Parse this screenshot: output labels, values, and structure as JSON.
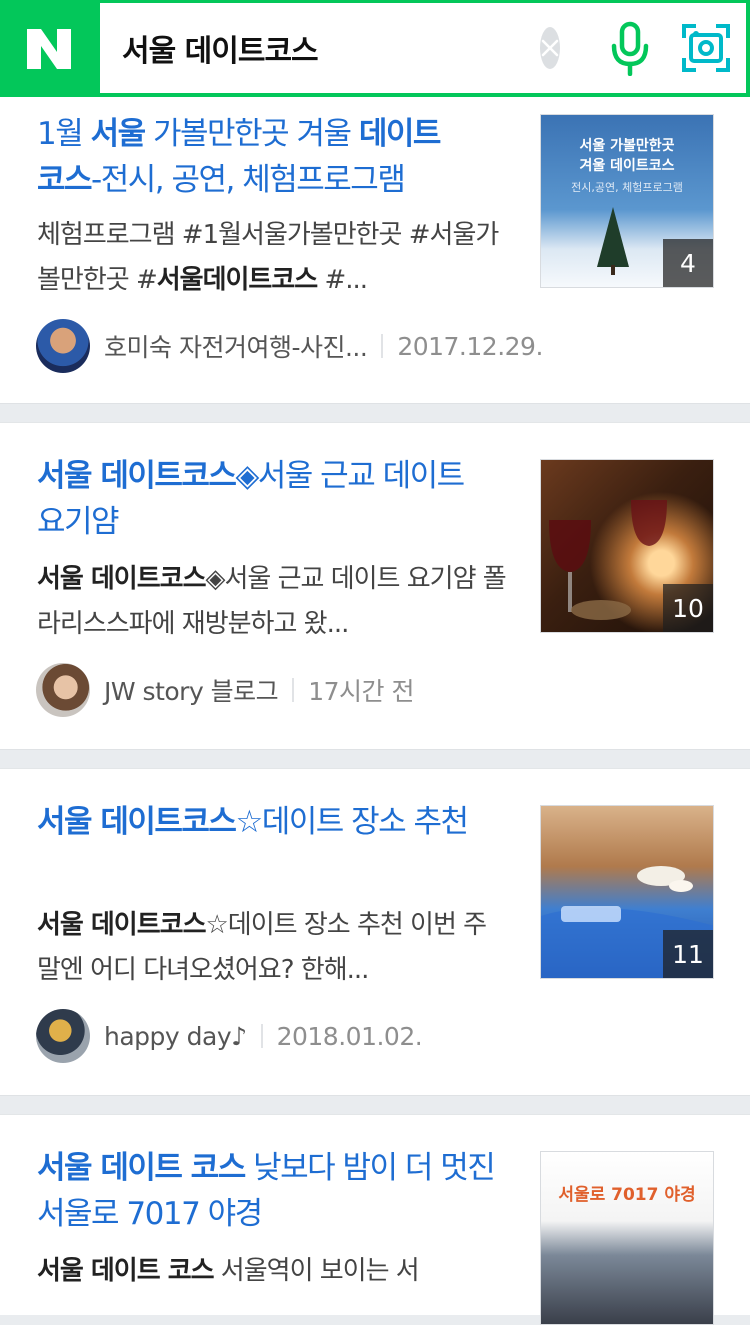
{
  "search": {
    "query": "서울 데이트코스"
  },
  "results": [
    {
      "title_parts": [
        "1월 ",
        "서울",
        " 가볼만한곳 겨울 ",
        "데이트 코스",
        "-전시, 공연, 체험프로그램"
      ],
      "desc_parts": [
        "체험프로그램 #1월서울가볼만한곳 #서울가볼만한곳 #",
        "서울데이트코스",
        " #..."
      ],
      "author": "호미숙 자전거여행-사진...",
      "date": "2017.12.29.",
      "image_count": "4",
      "thumb_text_1": "서울 가볼만한곳",
      "thumb_text_2": "겨울 데이트코스",
      "thumb_text_3": "전시,공연, 체험프로그램"
    },
    {
      "title_parts": [
        "서울 데이트코스",
        "◈서울 근교 데이트 요기얌"
      ],
      "desc_parts": [
        "서울 데이트코스",
        "◈서울 근교 데이트 요기얌 폴라리스스파에 재방분하고 왔..."
      ],
      "author": "JW story 블로그",
      "date": "17시간 전",
      "image_count": "10"
    },
    {
      "title_parts": [
        "서울 데이트코스",
        "☆데이트 장소 추천"
      ],
      "desc_parts": [
        "서울 데이트코스",
        "☆데이트 장소 추천 이번 주말엔 어디 다녀오셨어요? 한해..."
      ],
      "author": "happy day♪",
      "date": "2018.01.02.",
      "image_count": "11"
    },
    {
      "title_parts": [
        "서울 데이트 코스",
        " 낮보다 밤이 더 멋진 서울로 7017 야경"
      ],
      "desc_parts": [
        "서울 데이트 코스",
        " 서울역이 보이는 서"
      ],
      "thumb_text_1": "서울로 7017 야경"
    }
  ],
  "colors": {
    "brand_green": "#03c75a",
    "title_blue": "#1e6dd2"
  },
  "icons": [
    "naver-logo-icon",
    "clear-icon",
    "microphone-icon",
    "lens-icon"
  ]
}
